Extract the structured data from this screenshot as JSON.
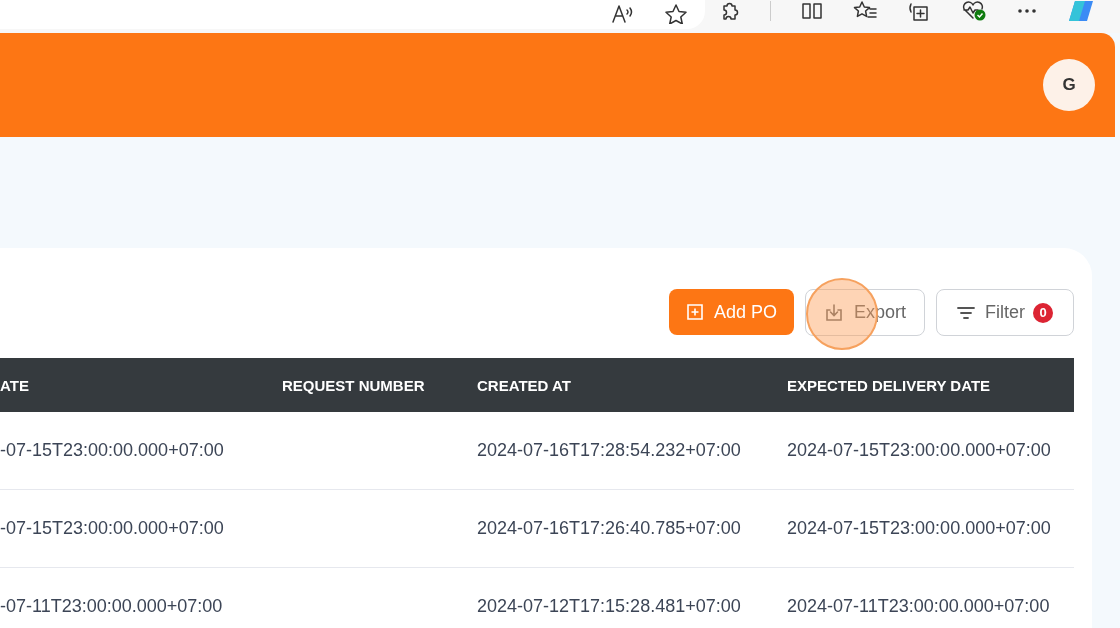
{
  "header": {
    "avatar": "G"
  },
  "actions": [
    {
      "kind": "primary",
      "label": "Add PO"
    },
    {
      "kind": "outline",
      "label": "Export"
    },
    {
      "kind": "filter",
      "label": "Filter",
      "badge": "0"
    }
  ],
  "click_highlight": {
    "on": true
  },
  "table": {
    "columns": [
      "ATE",
      "REQUEST NUMBER",
      "CREATED AT",
      "EXPECTED DELIVERY DATE"
    ],
    "rows": [
      {
        "column_1": "-07-15T23:00:00.000+07:00",
        "created_at": "2024-07-16T17:28:54.232+07:00",
        "expected_delivery_date": "2024-07-15T23:00:00.000+07:00"
      },
      {
        "column_1": "-07-15T23:00:00.000+07:00",
        "created_at": "2024-07-16T17:26:40.785+07:00",
        "expected_delivery_date": "2024-07-15T23:00:00.000+07:00"
      },
      {
        "column_1": "-07-11T23:00:00.000+07:00",
        "created_at": "2024-07-12T17:15:28.481+07:00",
        "expected_delivery_date": "2024-07-11T23:00:00.000+07:00"
      }
    ]
  }
}
